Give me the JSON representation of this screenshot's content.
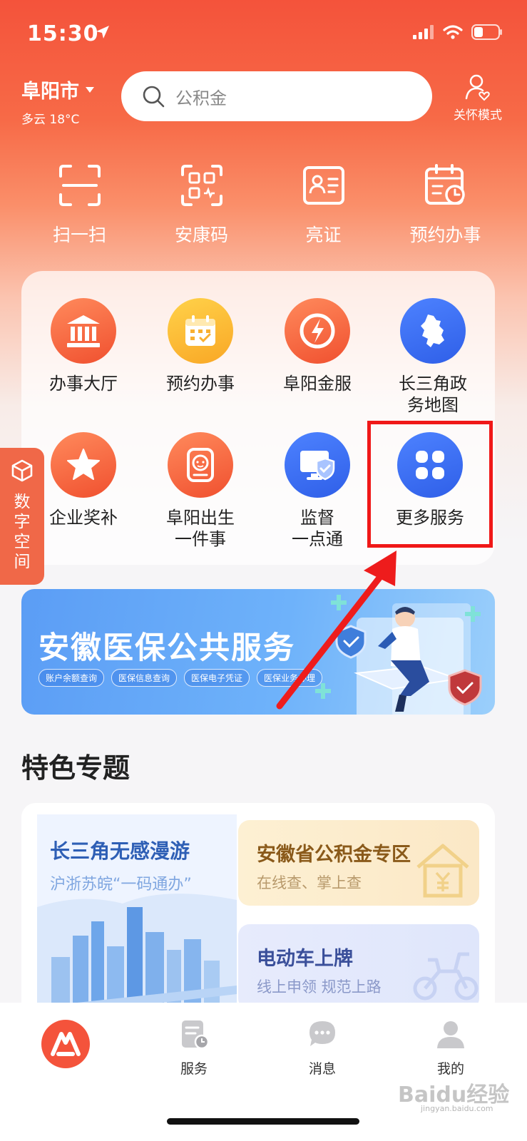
{
  "status_bar": {
    "time": "15:30"
  },
  "header": {
    "city": "阜阳市",
    "weather": "多云 18°C",
    "search_placeholder": "公积金",
    "care_mode": "关怀模式"
  },
  "quick_actions": [
    {
      "label": "扫一扫",
      "icon": "scan-icon"
    },
    {
      "label": "安康码",
      "icon": "qr-health-icon"
    },
    {
      "label": "亮证",
      "icon": "id-card-icon"
    },
    {
      "label": "预约办事",
      "icon": "calendar-clock-icon"
    }
  ],
  "services": [
    {
      "lines": [
        "办事大厅",
        ""
      ],
      "icon": "bank-hall-icon"
    },
    {
      "lines": [
        "预约办事",
        ""
      ],
      "icon": "calendar-icon"
    },
    {
      "lines": [
        "阜阳金服",
        ""
      ],
      "icon": "finance-icon"
    },
    {
      "lines": [
        "长三角政",
        "务地图"
      ],
      "icon": "map-icon"
    },
    {
      "lines": [
        "企业奖补",
        ""
      ],
      "icon": "star-icon"
    },
    {
      "lines": [
        "阜阳出生",
        "一件事"
      ],
      "icon": "baby-icon"
    },
    {
      "lines": [
        "监督",
        "一点通"
      ],
      "icon": "monitor-shield-icon"
    },
    {
      "lines": [
        "更多服务",
        ""
      ],
      "icon": "grid-more-icon"
    }
  ],
  "side_tab": {
    "label": "数字空间"
  },
  "banner": {
    "title": "安徽医保公共服务",
    "tags": [
      "账户余额查询",
      "医保信息查询",
      "医保电子凭证",
      "医保业务办理"
    ]
  },
  "featured": {
    "title": "特色专题",
    "left": {
      "title": "长三角无感漫游",
      "subtitle": "沪浙苏皖“一码通办”"
    },
    "gjj": {
      "title": "安徽省公积金专区",
      "subtitle": "在线查、掌上查"
    },
    "ev": {
      "title": "电动车上牌",
      "subtitle": "线上申领 规范上路"
    }
  },
  "tabbar": {
    "items": [
      {
        "label": "",
        "icon": "home-logo-icon"
      },
      {
        "label": "服务",
        "icon": "service-doc-icon"
      },
      {
        "label": "消息",
        "icon": "message-icon"
      },
      {
        "label": "我的",
        "icon": "profile-icon"
      }
    ]
  },
  "watermark": {
    "text": "Baidu经验",
    "sub": "jingyan.baidu.com"
  },
  "colors": {
    "primary": "#f4533b",
    "highlight_box": "#f01818",
    "banner_blue": "#5b9df5"
  }
}
